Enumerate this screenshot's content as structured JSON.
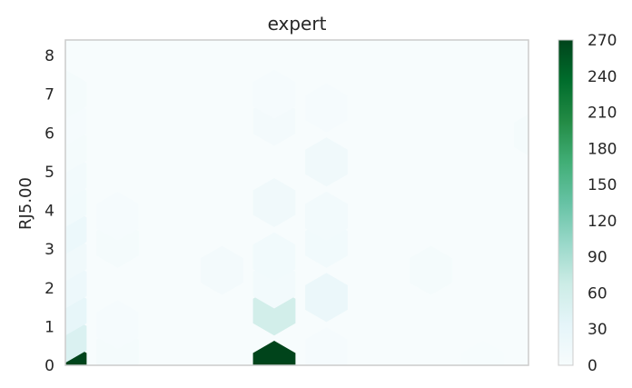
{
  "chart_data": {
    "type": "hexbin",
    "title": "expert",
    "xlabel": "",
    "ylabel": "RJ5.00",
    "ylim": [
      0,
      8.4
    ],
    "y_ticks": [
      "0",
      "1",
      "2",
      "3",
      "4",
      "5",
      "6",
      "7",
      "8"
    ],
    "x_ticks": [],
    "grid": false,
    "colormap": "BuGn",
    "colors": [
      "#f7fcfd",
      "#e5f5f9",
      "#ccece6",
      "#99d8c9",
      "#66c2a4",
      "#41ae76",
      "#238b45",
      "#006d2c",
      "#00441b"
    ],
    "colorbar": {
      "range": [
        0,
        270
      ],
      "ticks": [
        "0",
        "30",
        "60",
        "90",
        "120",
        "150",
        "180",
        "210",
        "240",
        "270"
      ]
    },
    "bins": [
      {
        "col": 0,
        "y": 0.0,
        "count": 270
      },
      {
        "col": 0,
        "y": 0.7,
        "count": 48
      },
      {
        "col": 0,
        "y": 1.4,
        "count": 30
      },
      {
        "col": 0,
        "y": 2.1,
        "count": 18
      },
      {
        "col": 0,
        "y": 2.8,
        "count": 14
      },
      {
        "col": 0,
        "y": 3.5,
        "count": 20
      },
      {
        "col": 0,
        "y": 4.2,
        "count": 12
      },
      {
        "col": 0,
        "y": 4.9,
        "count": 10
      },
      {
        "col": 0,
        "y": 5.6,
        "count": 6
      },
      {
        "col": 0,
        "y": 6.3,
        "count": 4
      },
      {
        "col": 0,
        "y": 7.0,
        "count": 5
      },
      {
        "col": 0.5,
        "y": 0.35,
        "count": 6
      },
      {
        "col": 0.5,
        "y": 1.05,
        "count": 4
      },
      {
        "col": 0.5,
        "y": 3.15,
        "count": 6
      },
      {
        "col": 0.5,
        "y": 3.85,
        "count": 3
      },
      {
        "col": 1.5,
        "y": 2.45,
        "count": 8
      },
      {
        "col": 2,
        "y": 0.0,
        "count": 270
      },
      {
        "col": 2,
        "y": 1.4,
        "count": 60
      },
      {
        "col": 2,
        "y": 2.1,
        "count": 10
      },
      {
        "col": 2,
        "y": 2.8,
        "count": 12
      },
      {
        "col": 2,
        "y": 4.2,
        "count": 14
      },
      {
        "col": 2,
        "y": 6.3,
        "count": 8
      },
      {
        "col": 2,
        "y": 7.0,
        "count": 4
      },
      {
        "col": 2.5,
        "y": 0.35,
        "count": 4
      },
      {
        "col": 2.5,
        "y": 1.75,
        "count": 22
      },
      {
        "col": 2.5,
        "y": 3.15,
        "count": 12
      },
      {
        "col": 2.5,
        "y": 3.85,
        "count": 10
      },
      {
        "col": 2.5,
        "y": 5.25,
        "count": 14
      },
      {
        "col": 2.5,
        "y": 6.65,
        "count": 4
      },
      {
        "col": 3.5,
        "y": 2.45,
        "count": 6
      },
      {
        "col": 4,
        "y": 0.0,
        "count": 2
      },
      {
        "col": 4.5,
        "y": 5.95,
        "count": 6
      }
    ]
  }
}
